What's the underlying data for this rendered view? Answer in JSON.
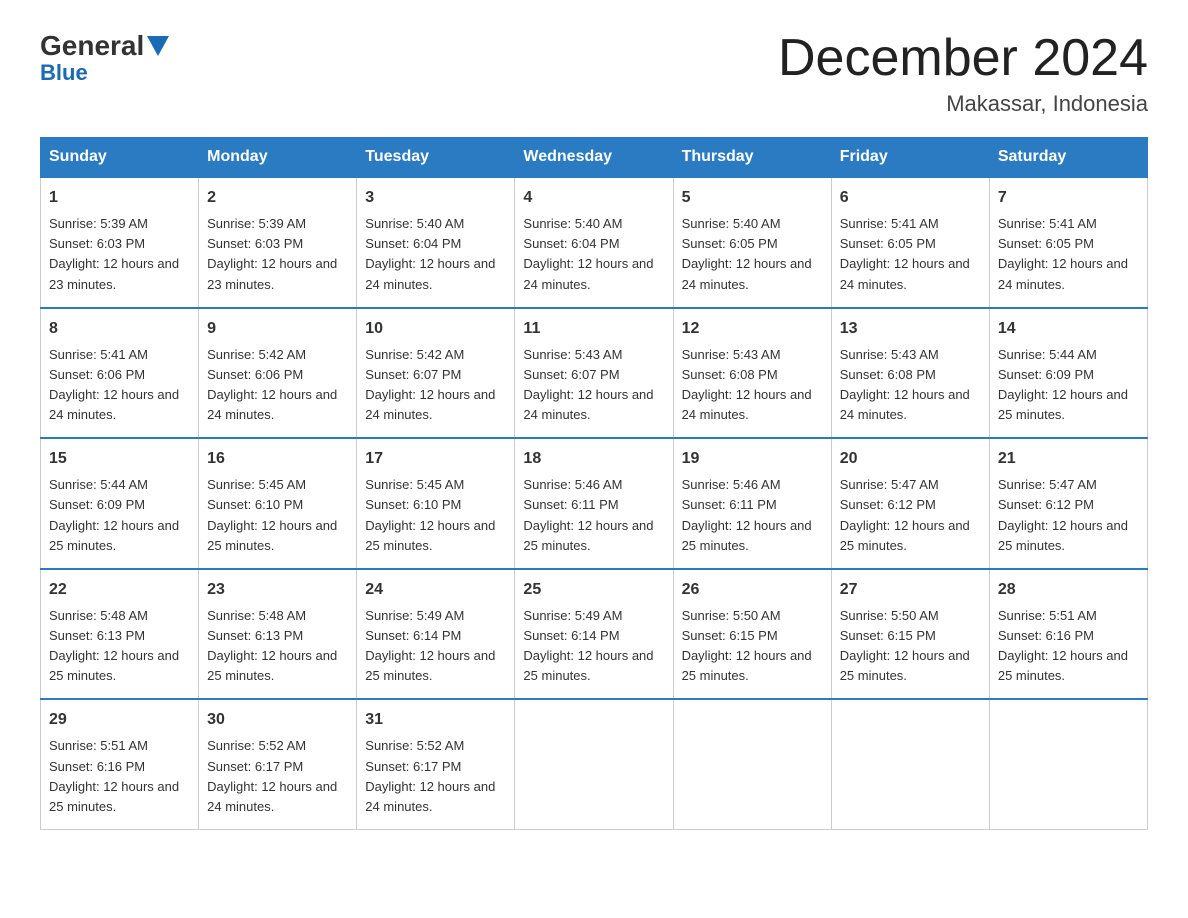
{
  "header": {
    "logo_general": "General",
    "logo_blue": "Blue",
    "month_title": "December 2024",
    "location": "Makassar, Indonesia"
  },
  "weekdays": [
    "Sunday",
    "Monday",
    "Tuesday",
    "Wednesday",
    "Thursday",
    "Friday",
    "Saturday"
  ],
  "weeks": [
    [
      {
        "day": "1",
        "sunrise": "5:39 AM",
        "sunset": "6:03 PM",
        "daylight": "12 hours and 23 minutes."
      },
      {
        "day": "2",
        "sunrise": "5:39 AM",
        "sunset": "6:03 PM",
        "daylight": "12 hours and 23 minutes."
      },
      {
        "day": "3",
        "sunrise": "5:40 AM",
        "sunset": "6:04 PM",
        "daylight": "12 hours and 24 minutes."
      },
      {
        "day": "4",
        "sunrise": "5:40 AM",
        "sunset": "6:04 PM",
        "daylight": "12 hours and 24 minutes."
      },
      {
        "day": "5",
        "sunrise": "5:40 AM",
        "sunset": "6:05 PM",
        "daylight": "12 hours and 24 minutes."
      },
      {
        "day": "6",
        "sunrise": "5:41 AM",
        "sunset": "6:05 PM",
        "daylight": "12 hours and 24 minutes."
      },
      {
        "day": "7",
        "sunrise": "5:41 AM",
        "sunset": "6:05 PM",
        "daylight": "12 hours and 24 minutes."
      }
    ],
    [
      {
        "day": "8",
        "sunrise": "5:41 AM",
        "sunset": "6:06 PM",
        "daylight": "12 hours and 24 minutes."
      },
      {
        "day": "9",
        "sunrise": "5:42 AM",
        "sunset": "6:06 PM",
        "daylight": "12 hours and 24 minutes."
      },
      {
        "day": "10",
        "sunrise": "5:42 AM",
        "sunset": "6:07 PM",
        "daylight": "12 hours and 24 minutes."
      },
      {
        "day": "11",
        "sunrise": "5:43 AM",
        "sunset": "6:07 PM",
        "daylight": "12 hours and 24 minutes."
      },
      {
        "day": "12",
        "sunrise": "5:43 AM",
        "sunset": "6:08 PM",
        "daylight": "12 hours and 24 minutes."
      },
      {
        "day": "13",
        "sunrise": "5:43 AM",
        "sunset": "6:08 PM",
        "daylight": "12 hours and 24 minutes."
      },
      {
        "day": "14",
        "sunrise": "5:44 AM",
        "sunset": "6:09 PM",
        "daylight": "12 hours and 25 minutes."
      }
    ],
    [
      {
        "day": "15",
        "sunrise": "5:44 AM",
        "sunset": "6:09 PM",
        "daylight": "12 hours and 25 minutes."
      },
      {
        "day": "16",
        "sunrise": "5:45 AM",
        "sunset": "6:10 PM",
        "daylight": "12 hours and 25 minutes."
      },
      {
        "day": "17",
        "sunrise": "5:45 AM",
        "sunset": "6:10 PM",
        "daylight": "12 hours and 25 minutes."
      },
      {
        "day": "18",
        "sunrise": "5:46 AM",
        "sunset": "6:11 PM",
        "daylight": "12 hours and 25 minutes."
      },
      {
        "day": "19",
        "sunrise": "5:46 AM",
        "sunset": "6:11 PM",
        "daylight": "12 hours and 25 minutes."
      },
      {
        "day": "20",
        "sunrise": "5:47 AM",
        "sunset": "6:12 PM",
        "daylight": "12 hours and 25 minutes."
      },
      {
        "day": "21",
        "sunrise": "5:47 AM",
        "sunset": "6:12 PM",
        "daylight": "12 hours and 25 minutes."
      }
    ],
    [
      {
        "day": "22",
        "sunrise": "5:48 AM",
        "sunset": "6:13 PM",
        "daylight": "12 hours and 25 minutes."
      },
      {
        "day": "23",
        "sunrise": "5:48 AM",
        "sunset": "6:13 PM",
        "daylight": "12 hours and 25 minutes."
      },
      {
        "day": "24",
        "sunrise": "5:49 AM",
        "sunset": "6:14 PM",
        "daylight": "12 hours and 25 minutes."
      },
      {
        "day": "25",
        "sunrise": "5:49 AM",
        "sunset": "6:14 PM",
        "daylight": "12 hours and 25 minutes."
      },
      {
        "day": "26",
        "sunrise": "5:50 AM",
        "sunset": "6:15 PM",
        "daylight": "12 hours and 25 minutes."
      },
      {
        "day": "27",
        "sunrise": "5:50 AM",
        "sunset": "6:15 PM",
        "daylight": "12 hours and 25 minutes."
      },
      {
        "day": "28",
        "sunrise": "5:51 AM",
        "sunset": "6:16 PM",
        "daylight": "12 hours and 25 minutes."
      }
    ],
    [
      {
        "day": "29",
        "sunrise": "5:51 AM",
        "sunset": "6:16 PM",
        "daylight": "12 hours and 25 minutes."
      },
      {
        "day": "30",
        "sunrise": "5:52 AM",
        "sunset": "6:17 PM",
        "daylight": "12 hours and 24 minutes."
      },
      {
        "day": "31",
        "sunrise": "5:52 AM",
        "sunset": "6:17 PM",
        "daylight": "12 hours and 24 minutes."
      },
      null,
      null,
      null,
      null
    ]
  ],
  "labels": {
    "sunrise": "Sunrise:",
    "sunset": "Sunset:",
    "daylight": "Daylight:"
  }
}
